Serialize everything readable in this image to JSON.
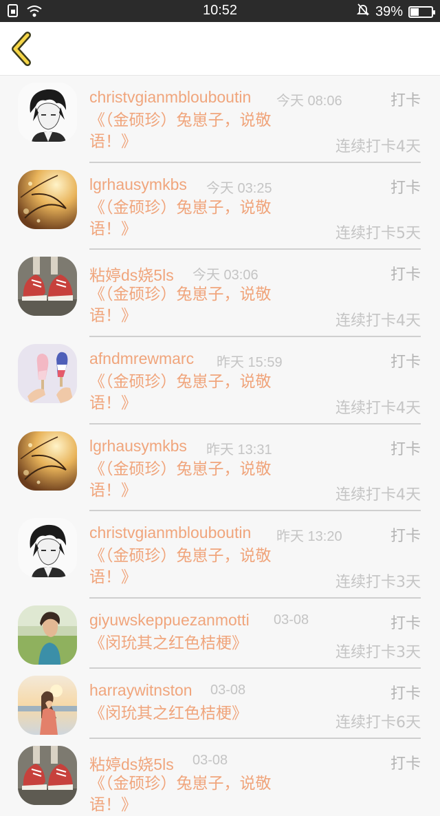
{
  "status_bar": {
    "time": "10:52",
    "battery_percent": "39%",
    "battery_level": 0.39,
    "icons": [
      "sim-icon",
      "wifi-icon",
      "silent-bell-icon",
      "battery-icon"
    ]
  },
  "nav": {
    "back_icon": "chevron-left-icon",
    "accent_color": "#f5d547"
  },
  "colors": {
    "username": "#f0a57c",
    "muted": "#c4c4c4",
    "background": "#f7f7f7"
  },
  "items": [
    {
      "username": "christvgianmblouboutin",
      "time": "今天 08:06",
      "action": "打卡",
      "post_line1": "《（金硕珍）兔崽子，说敬",
      "post_line2": "语！》",
      "streak": "连续打卡4天",
      "avatar": "anime-boy"
    },
    {
      "username": "lgrhausymkbs",
      "time": "今天 03:25",
      "action": "打卡",
      "post_line1": "《（金硕珍）兔崽子，说敬",
      "post_line2": "语！》",
      "streak": "连续打卡5天",
      "avatar": "golden-bokeh"
    },
    {
      "username": "粘婷ds娆5ls",
      "time": "今天 03:06",
      "action": "打卡",
      "post_line1": "《（金硕珍）兔崽子，说敬",
      "post_line2": "语！》",
      "streak": "连续打卡4天",
      "avatar": "red-sneakers"
    },
    {
      "username": "afndmrewmarc",
      "time": "昨天 15:59",
      "action": "打卡",
      "post_line1": "《（金硕珍）兔崽子，说敬",
      "post_line2": "语！》",
      "streak": "连续打卡4天",
      "avatar": "popsicles"
    },
    {
      "username": "lgrhausymkbs",
      "time": "昨天 13:31",
      "action": "打卡",
      "post_line1": "《（金硕珍）兔崽子，说敬",
      "post_line2": "语！》",
      "streak": "连续打卡4天",
      "avatar": "golden-bokeh"
    },
    {
      "username": "christvgianmblouboutin",
      "time": "昨天 13:20",
      "action": "打卡",
      "post_line1": "《（金硕珍）兔崽子，说敬",
      "post_line2": "语！》",
      "streak": "连续打卡3天",
      "avatar": "anime-boy"
    },
    {
      "username": "giyuwskeppuezanmotti",
      "time": "03-08",
      "action": "打卡",
      "post_line1": "《闵玧其之红色桔梗》",
      "post_line2": "",
      "streak": "连续打卡3天",
      "avatar": "boy-field"
    },
    {
      "username": "harraywitnston",
      "time": "03-08",
      "action": "打卡",
      "post_line1": "《闵玧其之红色桔梗》",
      "post_line2": "",
      "streak": "连续打卡6天",
      "avatar": "girl-sunset"
    },
    {
      "username": "粘婷ds娆5ls",
      "time": "03-08",
      "action": "打卡",
      "post_line1": "《（金硕珍）兔崽子，说敬",
      "post_line2": "语！》",
      "streak": "",
      "avatar": "red-sneakers"
    }
  ]
}
